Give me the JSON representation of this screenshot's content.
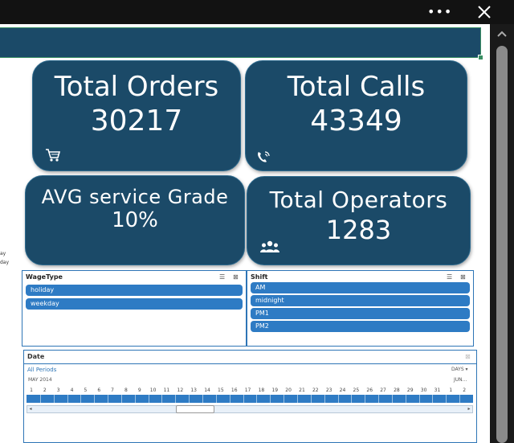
{
  "window": {
    "more_label": "•••"
  },
  "edge_texts": [
    "ay",
    "day"
  ],
  "kpis": {
    "orders": {
      "title": "Total Orders",
      "value": "30217",
      "icon": "shopping-cart-icon"
    },
    "calls": {
      "title": "Total Calls",
      "value": "43349",
      "icon": "phone-call-icon"
    },
    "service": {
      "title": "AVG service Grade",
      "value": "10%"
    },
    "operators": {
      "title": "Total Operators",
      "value": "1283",
      "icon": "people-icon"
    }
  },
  "slicers": {
    "wagetype": {
      "title": "WageType",
      "items": [
        "holiday",
        "weekday"
      ]
    },
    "shift": {
      "title": "Shift",
      "items": [
        "AM",
        "midnight",
        "PM1",
        "PM2"
      ]
    }
  },
  "timeline": {
    "title": "Date",
    "all_periods": "All Periods",
    "level": "DAYS ▾",
    "month_label": "MAY 2014",
    "next_month_label": "JUN...",
    "days": [
      "1",
      "2",
      "3",
      "4",
      "5",
      "6",
      "7",
      "8",
      "9",
      "10",
      "11",
      "12",
      "13",
      "14",
      "15",
      "16",
      "17",
      "18",
      "19",
      "20",
      "21",
      "22",
      "23",
      "24",
      "25",
      "26",
      "27",
      "28",
      "29",
      "30",
      "31",
      "1",
      "2"
    ]
  },
  "colors": {
    "card": "#1b4a68",
    "accent": "#2e7bc4",
    "chrome": "#121212"
  }
}
